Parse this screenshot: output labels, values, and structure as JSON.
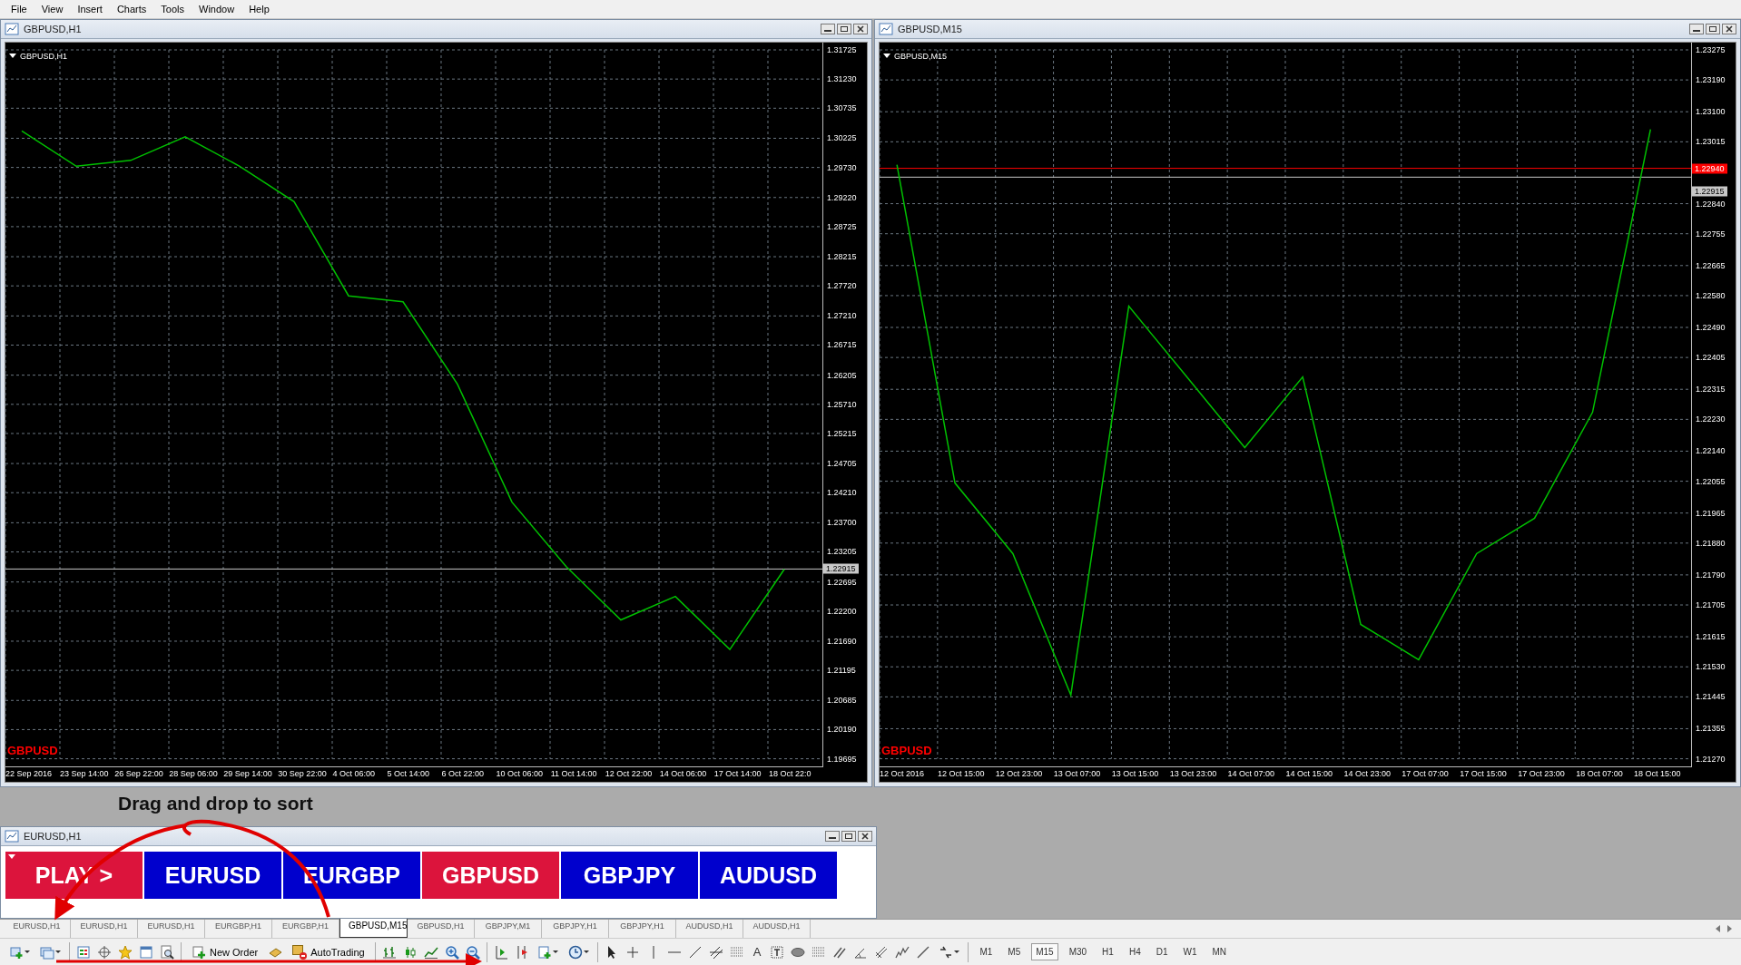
{
  "menu": [
    "File",
    "View",
    "Insert",
    "Charts",
    "Tools",
    "Window",
    "Help"
  ],
  "chart_windows": [
    {
      "title": "GBPUSD,H1",
      "chart_label": "GBPUSD,H1",
      "symbol_overlay": "GBPUSD",
      "chart_data": {
        "type": "line",
        "grid": true,
        "categories": [
          "22 Sep 2016",
          "23 Sep 14:00",
          "26 Sep 22:00",
          "28 Sep 06:00",
          "29 Sep 14:00",
          "30 Sep 22:00",
          "4 Oct 06:00",
          "5 Oct 14:00",
          "6 Oct 22:00",
          "10 Oct 06:00",
          "11 Oct 14:00",
          "12 Oct 22:00",
          "14 Oct 06:00",
          "17 Oct 14:00",
          "18 Oct 22:0"
        ],
        "series": [
          {
            "color": "#00c000",
            "values": [
              1.3035,
              1.2975,
              1.2985,
              1.3025,
              1.2975,
              1.2915,
              1.2755,
              1.2745,
              1.2605,
              1.2405,
              1.2295,
              1.2205,
              1.2245,
              1.2155,
              1.2291
            ]
          }
        ],
        "ylim": [
          1.19695,
          1.31725
        ],
        "yticks": [
          {
            "value": 1.31725,
            "label": "1.31725"
          },
          {
            "value": 1.3123,
            "label": "1.31230"
          },
          {
            "value": 1.30735,
            "label": "1.30735"
          },
          {
            "value": 1.30225,
            "label": "1.30225"
          },
          {
            "value": 1.2973,
            "label": "1.29730"
          },
          {
            "value": 1.2922,
            "label": "1.29220"
          },
          {
            "value": 1.28725,
            "label": "1.28725"
          },
          {
            "value": 1.28215,
            "label": "1.28215"
          },
          {
            "value": 1.2772,
            "label": "1.27720"
          },
          {
            "value": 1.2721,
            "label": "1.27210"
          },
          {
            "value": 1.26715,
            "label": "1.26715"
          },
          {
            "value": 1.26205,
            "label": "1.26205"
          },
          {
            "value": 1.2571,
            "label": "1.25710"
          },
          {
            "value": 1.25215,
            "label": "1.25215"
          },
          {
            "value": 1.24705,
            "label": "1.24705"
          },
          {
            "value": 1.2421,
            "label": "1.24210"
          },
          {
            "value": 1.237,
            "label": "1.23700"
          },
          {
            "value": 1.23205,
            "label": "1.23205"
          },
          {
            "value": 1.22695,
            "label": "1.22695"
          },
          {
            "value": 1.222,
            "label": "1.22200"
          },
          {
            "value": 1.2169,
            "label": "1.21690"
          },
          {
            "value": 1.21195,
            "label": "1.21195"
          },
          {
            "value": 1.20685,
            "label": "1.20685"
          },
          {
            "value": 1.2019,
            "label": "1.20190"
          },
          {
            "value": 1.19695,
            "label": "1.19695"
          }
        ],
        "ref_lines": [
          {
            "axis": "y",
            "value": 1.22915,
            "label": "1.22915",
            "color": "#c8c8c8"
          }
        ]
      }
    },
    {
      "title": "GBPUSD,M15",
      "chart_label": "GBPUSD,M15",
      "symbol_overlay": "GBPUSD",
      "chart_data": {
        "type": "line",
        "grid": true,
        "categories": [
          "12 Oct 2016",
          "12 Oct 15:00",
          "12 Oct 23:00",
          "13 Oct 07:00",
          "13 Oct 15:00",
          "13 Oct 23:00",
          "14 Oct 07:00",
          "14 Oct 15:00",
          "14 Oct 23:00",
          "17 Oct 07:00",
          "17 Oct 15:00",
          "17 Oct 23:00",
          "18 Oct 07:00",
          "18 Oct 15:00"
        ],
        "series": [
          {
            "color": "#00c000",
            "values": [
              1.2295,
              1.2205,
              1.2185,
              1.2145,
              1.2255,
              1.2235,
              1.2215,
              1.2235,
              1.2165,
              1.2155,
              1.2185,
              1.2195,
              1.2225,
              1.2305
            ]
          }
        ],
        "ylim": [
          1.2127,
          1.23275
        ],
        "yticks": [
          {
            "value": 1.23275,
            "label": "1.23275"
          },
          {
            "value": 1.2319,
            "label": "1.23190"
          },
          {
            "value": 1.231,
            "label": "1.23100"
          },
          {
            "value": 1.23015,
            "label": "1.23015"
          },
          {
            "value": 1.2284,
            "label": "1.22840"
          },
          {
            "value": 1.22755,
            "label": "1.22755"
          },
          {
            "value": 1.22665,
            "label": "1.22665"
          },
          {
            "value": 1.2258,
            "label": "1.22580"
          },
          {
            "value": 1.2249,
            "label": "1.22490"
          },
          {
            "value": 1.22405,
            "label": "1.22405"
          },
          {
            "value": 1.22315,
            "label": "1.22315"
          },
          {
            "value": 1.2223,
            "label": "1.22230"
          },
          {
            "value": 1.2214,
            "label": "1.22140"
          },
          {
            "value": 1.22055,
            "label": "1.22055"
          },
          {
            "value": 1.21965,
            "label": "1.21965"
          },
          {
            "value": 1.2188,
            "label": "1.21880"
          },
          {
            "value": 1.2179,
            "label": "1.21790"
          },
          {
            "value": 1.21705,
            "label": "1.21705"
          },
          {
            "value": 1.21615,
            "label": "1.21615"
          },
          {
            "value": 1.2153,
            "label": "1.21530"
          },
          {
            "value": 1.21445,
            "label": "1.21445"
          },
          {
            "value": 1.21355,
            "label": "1.21355"
          },
          {
            "value": 1.2127,
            "label": "1.21270"
          }
        ],
        "ref_lines": [
          {
            "axis": "y",
            "value": 1.2294,
            "label": "1.22940",
            "color": "#ff0000"
          },
          {
            "axis": "y",
            "value": 1.22915,
            "label": "1.22915",
            "color": "#c8c8c8"
          }
        ]
      }
    }
  ],
  "caption": "Drag and drop to sort",
  "symbol_window": {
    "title": "EURUSD,H1",
    "buttons": [
      {
        "label": "PLAY >",
        "color": "#dc143c"
      },
      {
        "label": "EURUSD",
        "color": "#0000cd"
      },
      {
        "label": "EURGBP",
        "color": "#0000cd"
      },
      {
        "label": "GBPUSD",
        "color": "#dc143c"
      },
      {
        "label": "GBPJPY",
        "color": "#0000cd"
      },
      {
        "label": "AUDUSD",
        "color": "#0000cd"
      }
    ]
  },
  "tabs": [
    {
      "label": "EURUSD,H1",
      "selected": false
    },
    {
      "label": "EURUSD,H1",
      "selected": false
    },
    {
      "label": "EURUSD,H1",
      "selected": false
    },
    {
      "label": "EURGBP,H1",
      "selected": false
    },
    {
      "label": "EURGBP,H1",
      "selected": false
    },
    {
      "label": "GBPUSD,M15",
      "selected": true
    },
    {
      "label": "GBPUSD,H1",
      "selected": false
    },
    {
      "label": "GBPJPY,M1",
      "selected": false
    },
    {
      "label": "GBPJPY,H1",
      "selected": false
    },
    {
      "label": "GBPJPY,H1",
      "selected": false
    },
    {
      "label": "AUDUSD,H1",
      "selected": false
    },
    {
      "label": "AUDUSD,H1",
      "selected": false
    }
  ],
  "toolbar": {
    "new_order": "New Order",
    "autotrading": "AutoTrading",
    "text_tool": "A",
    "timeframes": [
      {
        "label": "M1",
        "selected": false
      },
      {
        "label": "M5",
        "selected": false
      },
      {
        "label": "M15",
        "selected": true
      },
      {
        "label": "M30",
        "selected": false
      },
      {
        "label": "H1",
        "selected": false
      },
      {
        "label": "H4",
        "selected": false
      },
      {
        "label": "D1",
        "selected": false
      },
      {
        "label": "W1",
        "selected": false
      },
      {
        "label": "MN",
        "selected": false
      }
    ]
  }
}
